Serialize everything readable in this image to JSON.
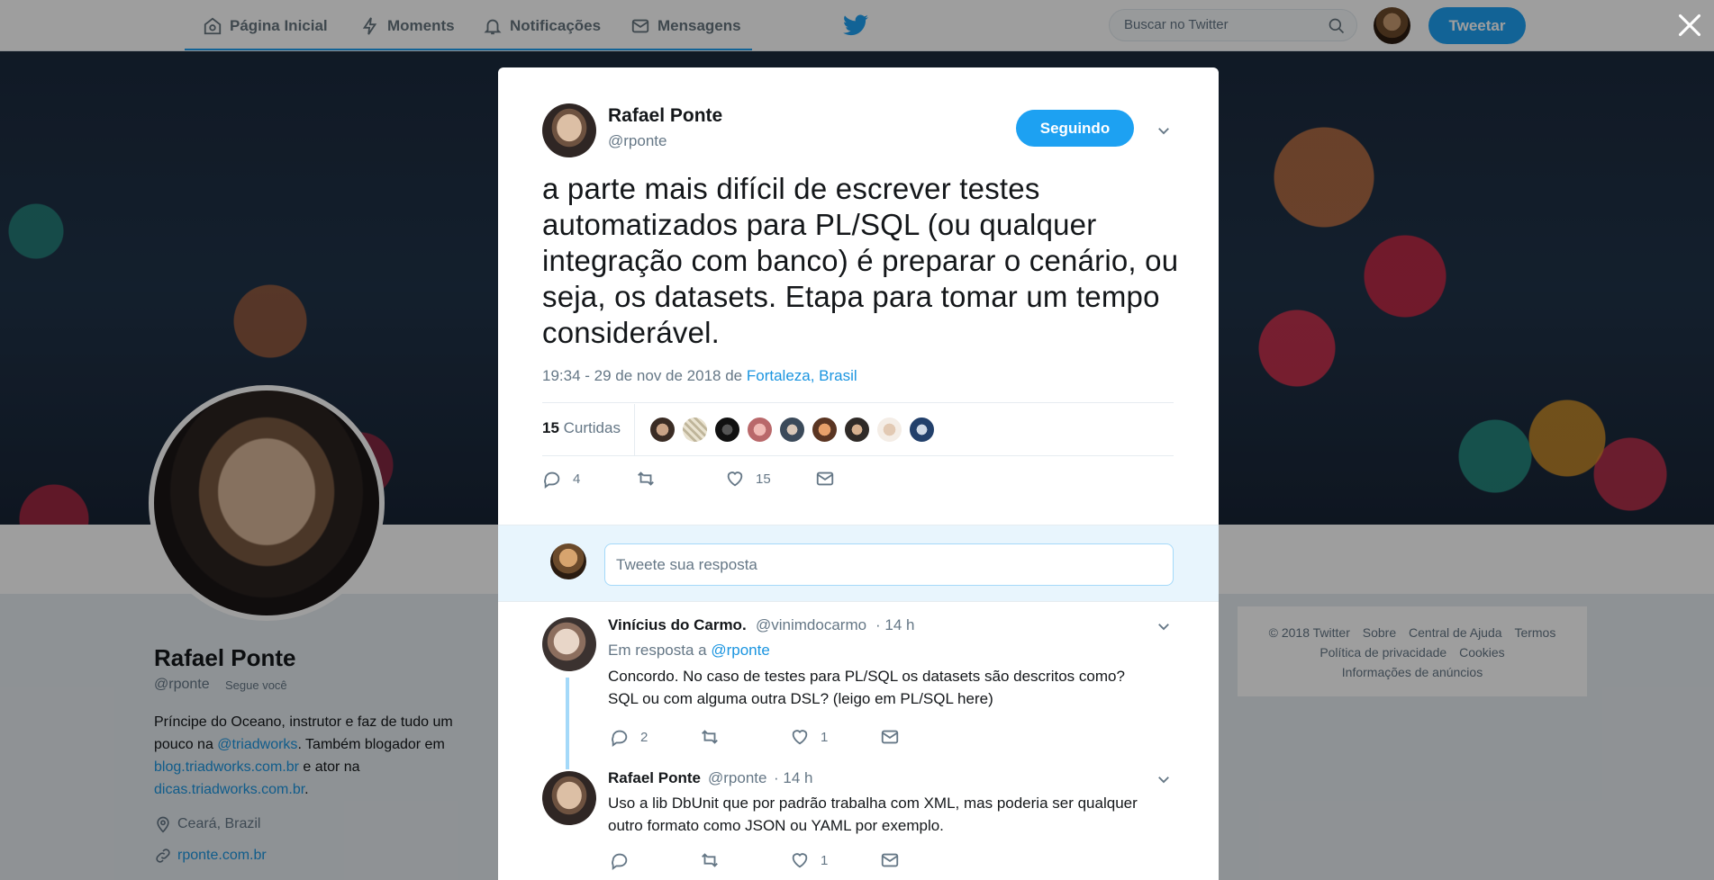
{
  "nav": {
    "home": "Página Inicial",
    "moments": "Moments",
    "notifications": "Notificações",
    "messages": "Mensagens",
    "search_placeholder": "Buscar no Twitter",
    "tweet_button": "Tweetar",
    "accent": "#1da1f2"
  },
  "profile": {
    "name": "Rafael Ponte",
    "handle": "@rponte",
    "follows_you": "Segue você",
    "bio_1": "Príncipe do Oceano, instrutor e faz de tudo um pouco na ",
    "bio_link_1": "@triadworks",
    "bio_2": ". Também blogador em ",
    "bio_link_2": "blog.triadworks.com.br",
    "bio_3": " e ator na ",
    "bio_link_3": "dicas.triadworks.com.br",
    "bio_4": ".",
    "location": "Ceará, Brazil",
    "url": "rponte.com.br"
  },
  "footer": {
    "copyright": "© 2018 Twitter",
    "about": "Sobre",
    "help": "Central de Ajuda",
    "terms": "Termos",
    "privacy": "Política de privacidade",
    "cookies": "Cookies",
    "ads": "Informações de anúncios"
  },
  "tweet": {
    "author_name": "Rafael Ponte",
    "author_handle": "@rponte",
    "follow_label": "Seguindo",
    "text": "a parte mais difícil de escrever testes automatizados para PL/SQL (ou qualquer integração com banco) é preparar o cenário, ou seja, os datasets. Etapa para tomar um tempo considerável.",
    "timestamp": "19:34 - 29 de nov de 2018 de ",
    "location": "Fortaleza, Brasil",
    "likes_count": "15",
    "likes_label": "Curtidas",
    "replies": "4",
    "retweets": "",
    "likes": "15"
  },
  "reply_box": {
    "placeholder": "Tweete sua resposta"
  },
  "replies": [
    {
      "name": "Vinícius do Carmo.",
      "handle": "@vinimdocarmo",
      "time": "· 14 h",
      "in_reply_prefix": "Em resposta a ",
      "in_reply_to": "@rponte",
      "text": "Concordo. No caso de testes para PL/SQL os datasets são descritos como? SQL ou com alguma outra DSL? (leigo em PL/SQL here)",
      "replies": "2",
      "likes": "1"
    },
    {
      "name": "Rafael Ponte",
      "handle": "@rponte",
      "time": "· 14 h",
      "text": "Uso a lib DbUnit que por padrão trabalha com XML, mas poderia ser qualquer outro formato como JSON ou YAML por exemplo.",
      "likes": "1"
    }
  ]
}
